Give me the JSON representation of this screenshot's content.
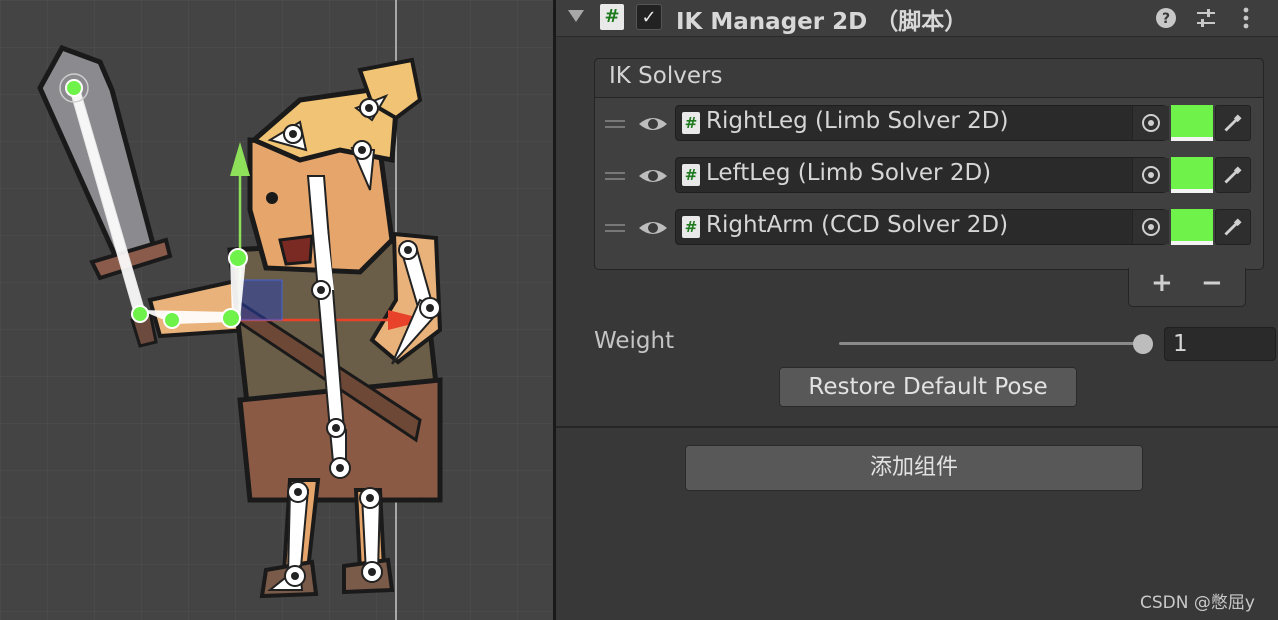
{
  "component": {
    "title": "IK Manager 2D （脚本）",
    "script_icon": "#",
    "enabled_check": "✓",
    "header_icons": [
      "help-icon",
      "preset-sliders-icon",
      "more-menu-icon"
    ]
  },
  "solvers": {
    "header": "IK Solvers",
    "items": [
      {
        "name": "RightLeg (Limb Solver 2D)",
        "hash": "#",
        "color": "#6ff24a"
      },
      {
        "name": "LeftLeg (Limb Solver 2D)",
        "hash": "#",
        "color": "#6ff24a"
      },
      {
        "name": "RightArm (CCD Solver 2D)",
        "hash": "#",
        "color": "#6ff24a"
      }
    ],
    "add_label": "+",
    "remove_label": "−"
  },
  "weight": {
    "label": "Weight",
    "value": "1",
    "slider_fraction": 1.0
  },
  "restore_button": "Restore Default Pose",
  "add_component_button": "添加组件",
  "watermark": "CSDN @憋屈y",
  "colors": {
    "accent_green": "#6ff24a",
    "panel_bg": "#383838",
    "scene_bg": "#444444",
    "handle_red": "#e8432a"
  }
}
